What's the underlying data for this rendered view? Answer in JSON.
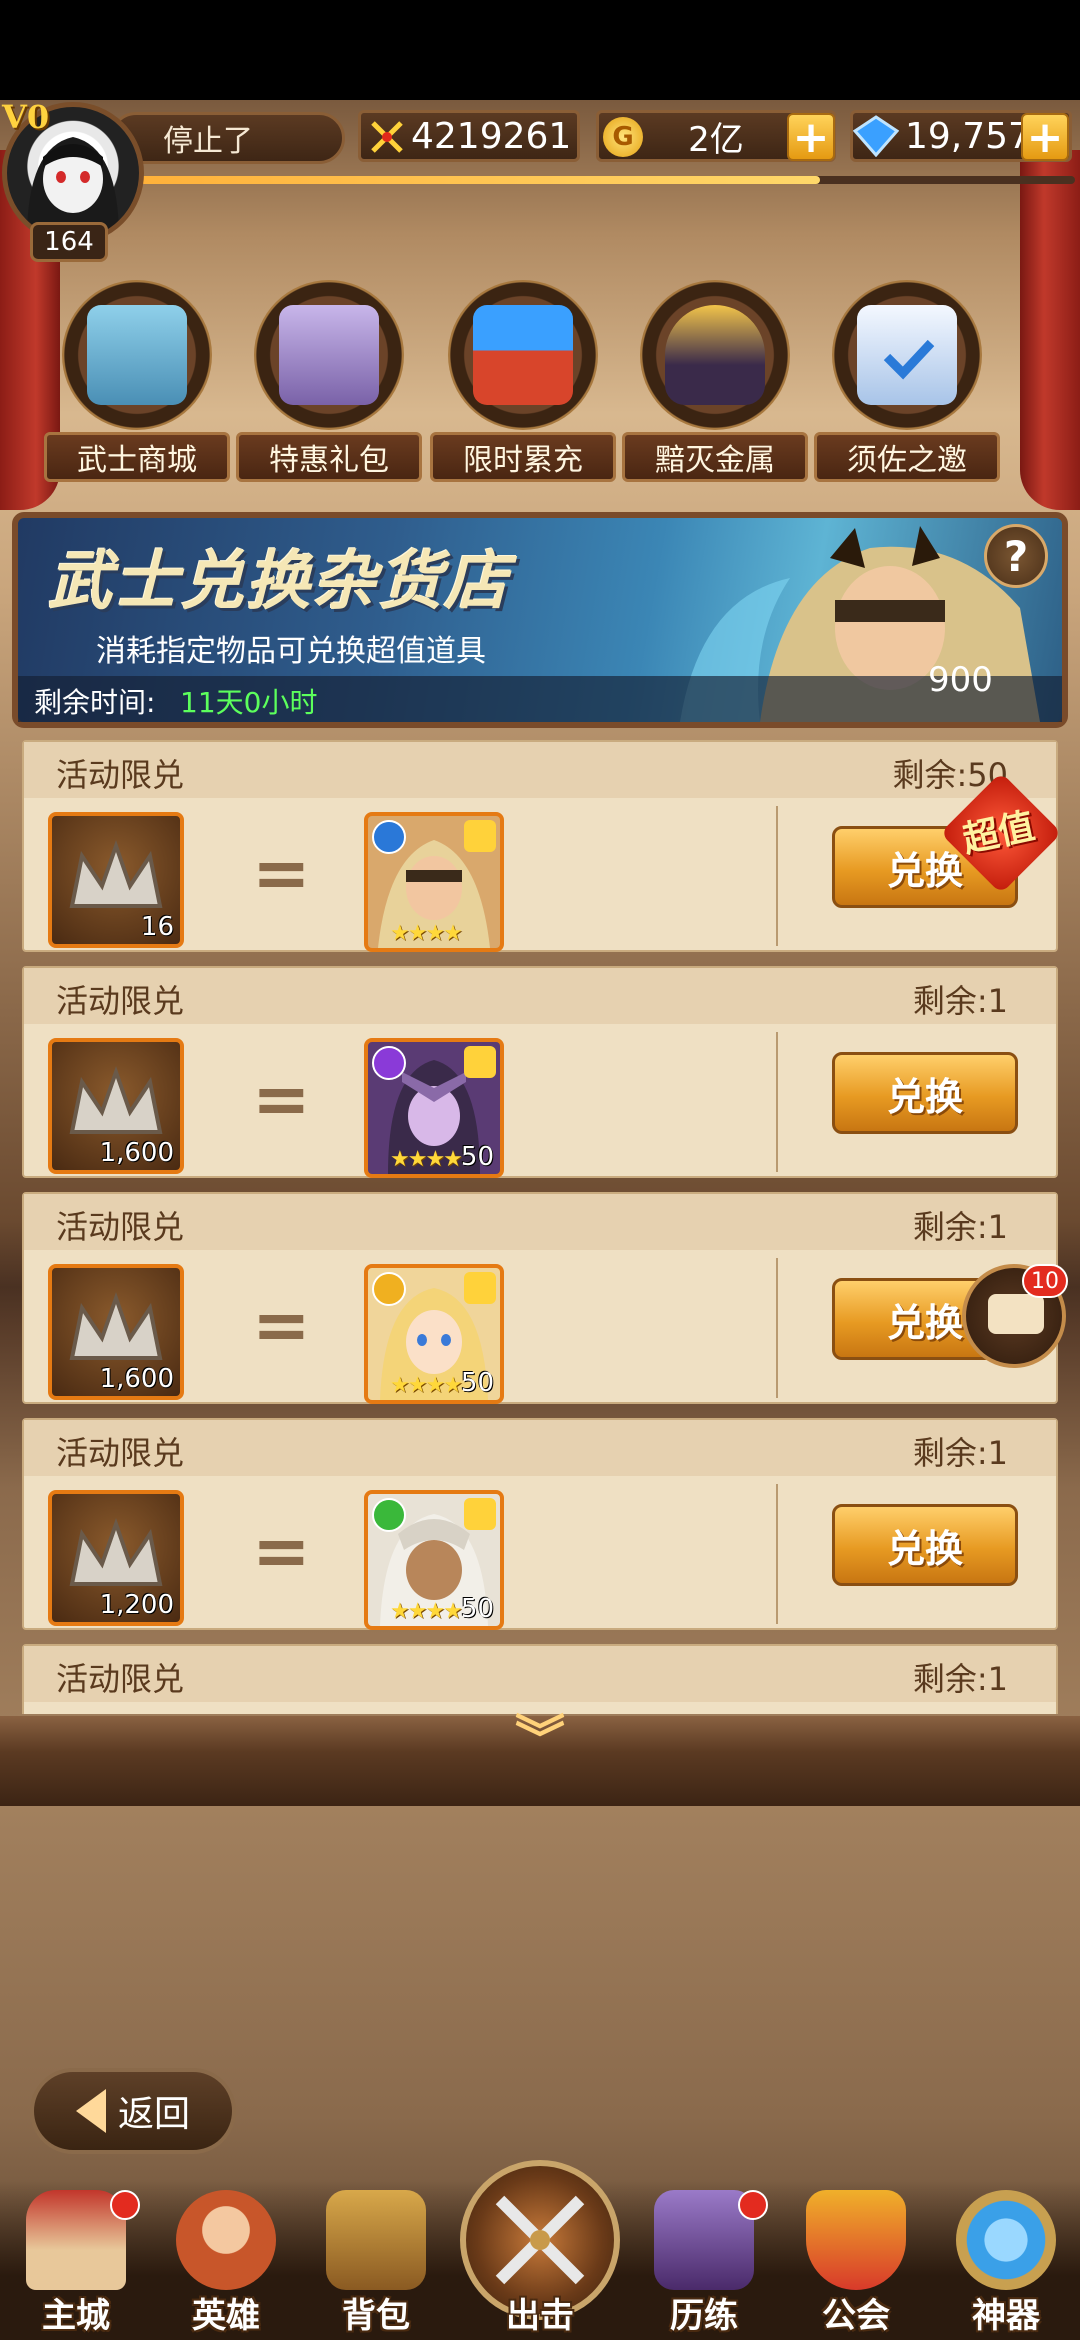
{
  "player": {
    "vip": "V0",
    "level": "164",
    "name": "停止了"
  },
  "currency": {
    "power": "4219261",
    "gold": "2亿",
    "gems": "19,757"
  },
  "shop_icons": [
    {
      "label": "武士商城",
      "icon": "chest-icon",
      "color": "#6fb9d8"
    },
    {
      "label": "特惠礼包",
      "icon": "gift-box-icon",
      "color": "#9b86c9"
    },
    {
      "label": "限时累充",
      "icon": "gem-crate-icon",
      "color": "#d8452b"
    },
    {
      "label": "黯灭金属",
      "icon": "samurai-helmet-icon",
      "color": "#d8a431"
    },
    {
      "label": "须佐之邀",
      "icon": "calendar-icon",
      "color": "#cfe0f2"
    }
  ],
  "banner": {
    "title": "武士兑换杂货店",
    "subtitle": "消耗指定物品可兑换超值道具",
    "time_label": "剩余时间:",
    "time_value": "11天0小时",
    "count": "900"
  },
  "exchange_items": [
    {
      "title": "活动限兑",
      "remaining": "剩余:50",
      "cost": "16",
      "reward_count": "",
      "stars": "★★★★",
      "element_color": "#2a78d8",
      "reward_bg": "#d9a86c",
      "button": "兑换"
    },
    {
      "title": "活动限兑",
      "remaining": "剩余:1",
      "cost": "1,600",
      "reward_count": "50",
      "stars": "★★★★",
      "element_color": "#8a3ad8",
      "reward_bg": "#5a3b74",
      "button": "兑换"
    },
    {
      "title": "活动限兑",
      "remaining": "剩余:1",
      "cost": "1,600",
      "reward_count": "50",
      "stars": "★★★★",
      "element_color": "#f0b020",
      "reward_bg": "#f0d59a",
      "button": "兑换"
    },
    {
      "title": "活动限兑",
      "remaining": "剩余:1",
      "cost": "1,200",
      "reward_count": "50",
      "stars": "★★★★",
      "element_color": "#3ab83a",
      "reward_bg": "#e8e2d6",
      "button": "兑换"
    },
    {
      "title": "活动限兑",
      "remaining": "剩余:1"
    }
  ],
  "super_badge": "超值",
  "chat_badge": "10",
  "back_label": "返回",
  "nav": [
    {
      "label": "主城",
      "icon": "castle-icon",
      "color": "#c2362b",
      "dot": true
    },
    {
      "label": "英雄",
      "icon": "hero-icon",
      "color": "#c8562a",
      "dot": false
    },
    {
      "label": "背包",
      "icon": "backpack-icon",
      "color": "#b88a3a",
      "dot": false
    },
    {
      "label": "出击",
      "icon": "crossed-swords-icon",
      "color": "#d0d0d0",
      "dot": false
    },
    {
      "label": "历练",
      "icon": "demon-chest-icon",
      "color": "#6a4a9a",
      "dot": true
    },
    {
      "label": "公会",
      "icon": "guild-shield-icon",
      "color": "#d83a2a",
      "dot": false
    },
    {
      "label": "神器",
      "icon": "artifact-gem-icon",
      "color": "#3aa0e8",
      "dot": false
    }
  ]
}
